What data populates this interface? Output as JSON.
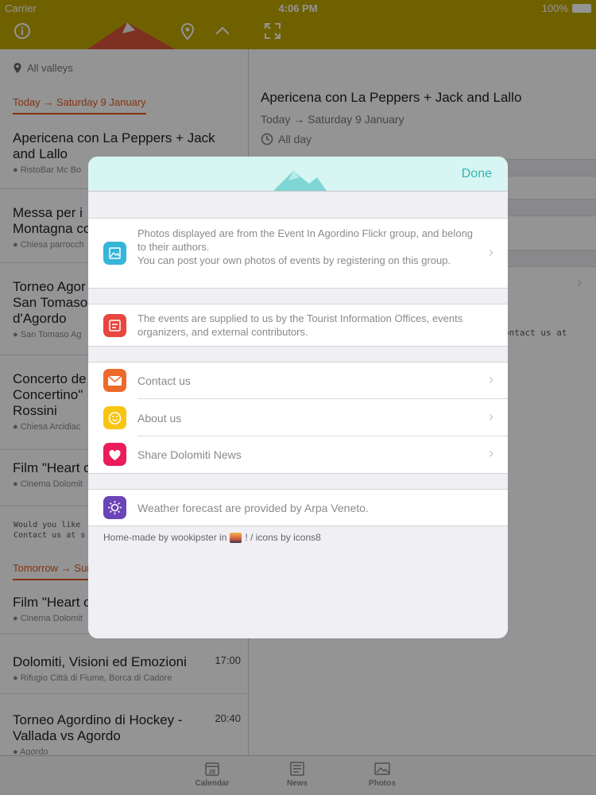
{
  "status": {
    "carrier": "Carrier",
    "time": "4:06 PM",
    "battery": "100%"
  },
  "list": {
    "location_filter": "All valleys",
    "section_today": "Today → Saturday 9 January",
    "section_tomorrow": "Tomorrow → Sun",
    "items": [
      {
        "title": "Apericena con La Peppers + Jack and Lallo",
        "place": "RistoBar Mc Bo",
        "time": ""
      },
      {
        "title": "Messa per i Montagna co",
        "place": "Chiesa parrocch",
        "time": ""
      },
      {
        "title": "Torneo Agor San Tomaso d'Agordo",
        "place": "San Tomaso Ag",
        "time": ""
      },
      {
        "title": "Concerto de Concertino\" Rossini",
        "place": "Chiesa Arcidiac",
        "time": ""
      },
      {
        "title": "Film \"Heart o",
        "place": "Cinema Dolomit",
        "time": ""
      },
      {
        "title": "Film \"Heart o",
        "place": "Cinema Dolomit",
        "time": ""
      },
      {
        "title": "Dolomiti, Visioni ed Emozioni",
        "place": "Rifugio Città di Fiume, Borca di Cadore",
        "time": "17:00"
      },
      {
        "title": "Torneo Agordino di Hockey - Vallada vs Agordo",
        "place": "Agordo",
        "time": "20:40"
      }
    ],
    "contact_line1": "Would you like",
    "contact_line2": "Contact us at s"
  },
  "detail": {
    "title": "Apericena con La Peppers + Jack and Lallo",
    "date": "Today → Saturday 9 January",
    "all_day": "All day",
    "contact_fragment": "ontact us at"
  },
  "tabs": [
    {
      "label": "Calendar",
      "day": "28"
    },
    {
      "label": "News"
    },
    {
      "label": "Photos"
    }
  ],
  "modal": {
    "done_label": "Done",
    "photos_text": "Photos displayed are from the Event In Agordino Flickr group, and belong to their authors.\nYou can post your own photos of events by registering on this group.",
    "events_text": "The events are supplied to us by the Tourist Information Offices, events organizers, and external contributors.",
    "contact_label": "Contact us",
    "about_label": "About us",
    "share_label": "Share Dolomiti News",
    "weather_text": "Weather forecast are provided by Arpa Veneto.",
    "footer_left": "Home-made by wookipster in",
    "footer_right": "! / icons by icons8"
  },
  "colors": {
    "header": "#bfa800",
    "accent_orange": "#e05a20",
    "done_teal": "#36b5b0",
    "photos_icon": "#35b5d8",
    "events_icon": "#e8463f",
    "contact_icon": "#ee6a2b",
    "about_icon": "#f7c513",
    "share_icon": "#ec1b5a",
    "weather_icon": "#6b45b8"
  }
}
